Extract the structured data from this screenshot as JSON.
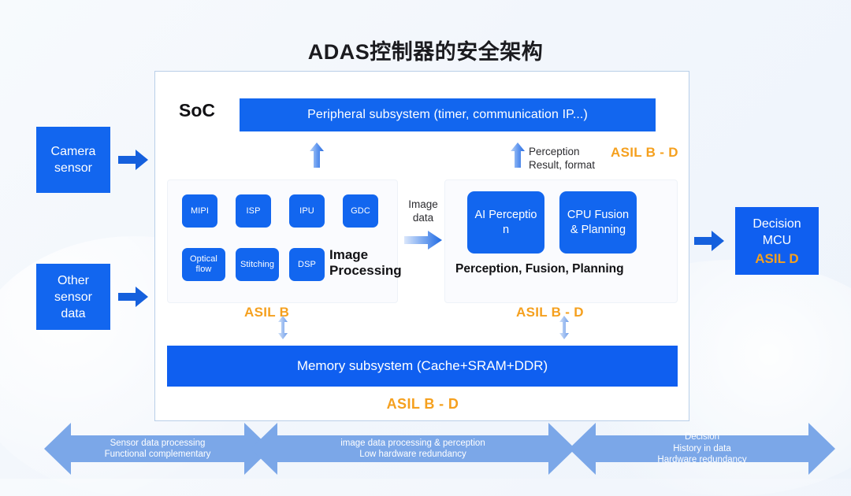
{
  "title": "ADAS控制器的安全架构",
  "theme": {
    "blue": "#1266ef",
    "blue_dark": "#0f5ff0",
    "orange": "#f5a01e",
    "banner_blue": "#7ba7e8",
    "background": "#f4f7fb"
  },
  "soc": {
    "label": "SoC",
    "peripheral_bar": "Peripheral subsystem (timer, communication IP...)",
    "perception_note": "Perception\nResult, format",
    "asil_top": "ASIL B - D",
    "image_data_label": "Image\ndata",
    "image_processing": {
      "caption": "Image\nProcessing",
      "asil": "ASIL B",
      "chips_row1": [
        "MIPI",
        "ISP",
        "IPU",
        "GDC"
      ],
      "chips_row2": [
        "Optical flow",
        "Stitching",
        "DSP"
      ]
    },
    "perception_block": {
      "chips": [
        "AI Perceptio n",
        "CPU Fusion & Planning"
      ],
      "caption": "Perception, Fusion, Planning",
      "asil": "ASIL B - D"
    },
    "memory_bar": "Memory subsystem (Cache+SRAM+DDR)",
    "asil_bottom": "ASIL B - D"
  },
  "inputs": {
    "camera_sensor": "Camera\nsensor",
    "other_sensor": "Other\nsensor\ndata"
  },
  "output": {
    "decision_label": "Decision\nMCU",
    "decision_asil": "ASIL D"
  },
  "banners": [
    {
      "text": "Sensor data processing\nFunctional complementary"
    },
    {
      "text": "image data processing & perception\nLow hardware redundancy"
    },
    {
      "text": "Decision\nHistory in data\nHardware redundancy"
    }
  ]
}
